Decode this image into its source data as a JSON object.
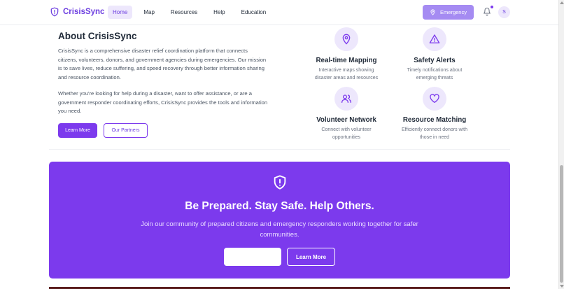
{
  "header": {
    "brand": "CrisisSync",
    "nav": [
      {
        "label": "Home",
        "active": true
      },
      {
        "label": "Map",
        "active": false
      },
      {
        "label": "Resources",
        "active": false
      },
      {
        "label": "Help",
        "active": false
      },
      {
        "label": "Education",
        "active": false
      }
    ],
    "emergency_label": "Emergency",
    "avatar_initial": "S",
    "notification_dot": true
  },
  "about": {
    "title": "About CrisisSync",
    "paragraph1": "CrisisSync is a comprehensive disaster relief coordination platform that connects citizens, volunteers, donors, and government agencies during emergencies. Our mission is to save lives, reduce suffering, and speed recovery through better information sharing and resource coordination.",
    "paragraph2": "Whether you're looking for help during a disaster, want to offer assistance, or are a government responder coordinating efforts, CrisisSync provides the tools and information you need.",
    "learn_more": "Learn More",
    "our_partners": "Our Partners"
  },
  "features": [
    {
      "icon": "map-pin-icon",
      "title": "Real-time Mapping",
      "description": "Interactive maps showing disaster areas and resources"
    },
    {
      "icon": "alert-triangle-icon",
      "title": "Safety Alerts",
      "description": "Timely notifications about emerging threats"
    },
    {
      "icon": "users-icon",
      "title": "Volunteer Network",
      "description": "Connect with volunteer opportunities"
    },
    {
      "icon": "heart-icon",
      "title": "Resource Matching",
      "description": "Efficiently connect donors with those in need"
    }
  ],
  "cta": {
    "icon": "shield-alert-icon",
    "title": "Be Prepared. Stay Safe. Help Others.",
    "text": "Join our community of prepared citizens and emergency responders working together for safer communities.",
    "primary_label": "",
    "secondary_label": "Learn More"
  },
  "colors": {
    "primary": "#7c3aed",
    "brand_text": "#6d3fe0",
    "emergency_button": "#a58bf2",
    "icon_bg": "#ede7fc"
  }
}
